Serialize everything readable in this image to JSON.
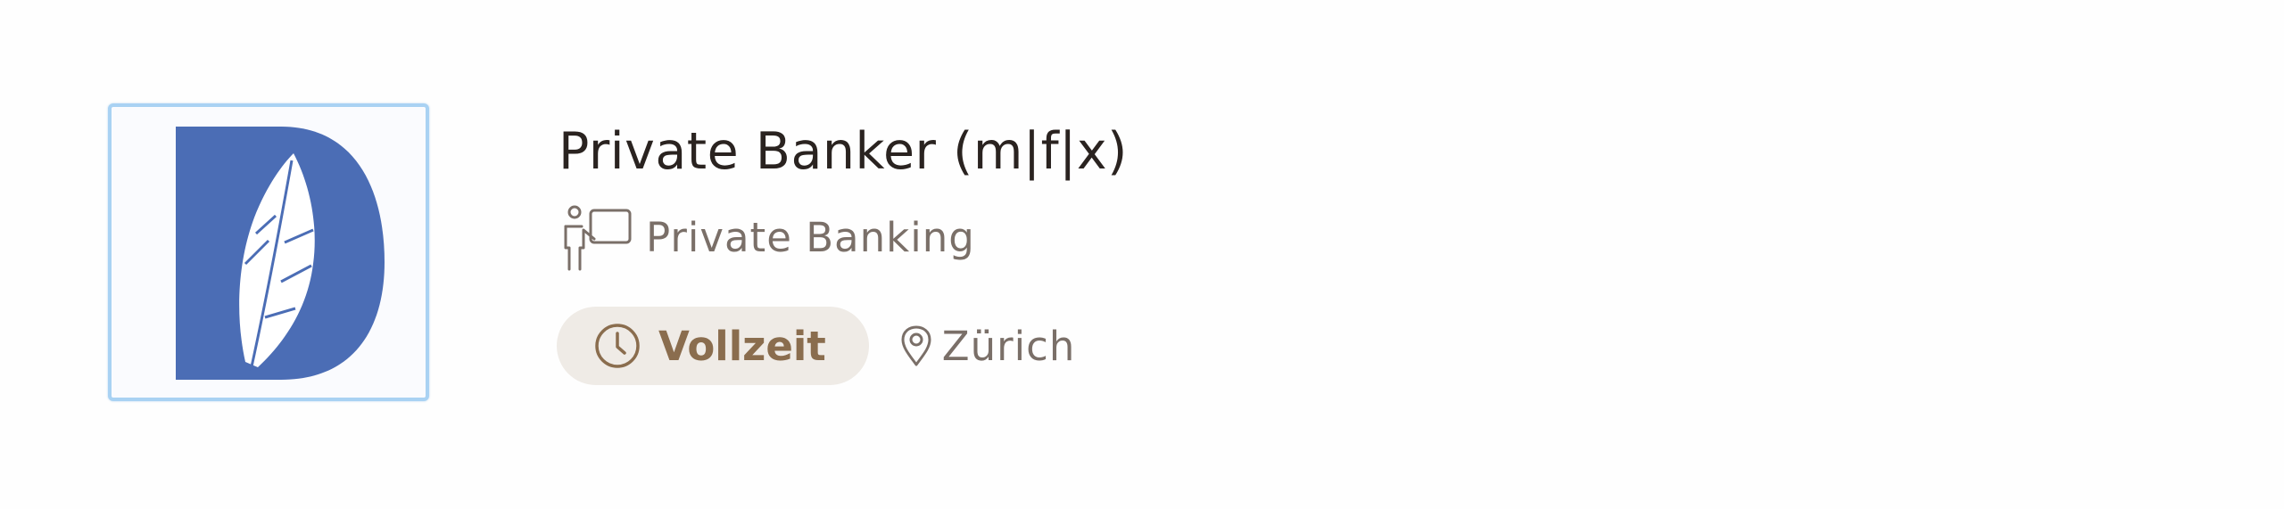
{
  "job": {
    "title": "Private Banker (m|f|x)",
    "department": "Private Banking",
    "employment_type": "Vollzeit",
    "location": "Zürich"
  },
  "icons": {
    "logo": "company-logo-d-feather",
    "department": "presenter-board-icon",
    "employment_type": "clock-icon",
    "location": "map-pin-icon"
  },
  "colors": {
    "logo_blue": "#4b6db5",
    "logo_border": "#a9d2f3",
    "title_text": "#2a2320",
    "muted_text": "#7a6f68",
    "badge_bg": "#efebe6",
    "badge_text": "#8a6d4e"
  }
}
